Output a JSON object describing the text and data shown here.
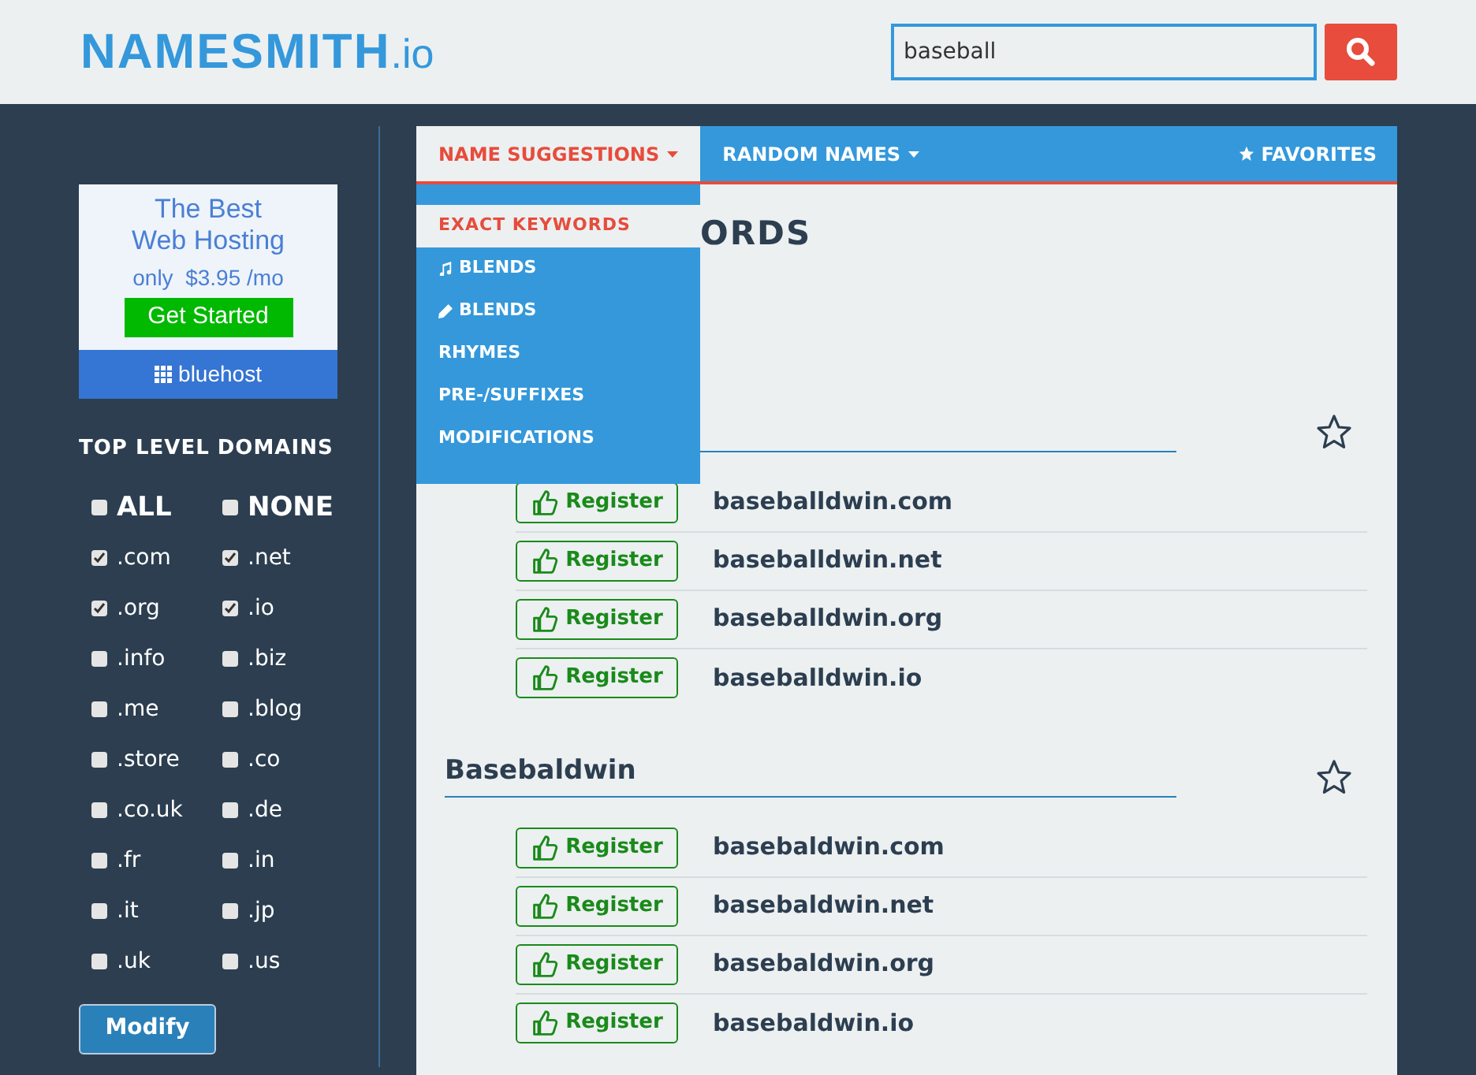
{
  "logo": {
    "name": "NAMESMITH",
    "suffix": ".io"
  },
  "search": {
    "value": "baseball"
  },
  "ad": {
    "line1": "The Best",
    "line2": "Web Hosting",
    "price_prefix": "only",
    "price": "$3.95 /mo",
    "button": "Get Started",
    "brand": "bluehost"
  },
  "sidebar": {
    "title": "TOP LEVEL DOMAINS",
    "options": [
      {
        "label": "ALL",
        "kind": "master",
        "checked": false
      },
      {
        "label": "NONE",
        "kind": "master",
        "checked": false
      },
      {
        "label": ".com",
        "kind": "tld",
        "checked": true
      },
      {
        "label": ".net",
        "kind": "tld",
        "checked": true
      },
      {
        "label": ".org",
        "kind": "tld",
        "checked": true
      },
      {
        "label": ".io",
        "kind": "tld",
        "checked": true
      },
      {
        "label": ".info",
        "kind": "tld",
        "checked": false
      },
      {
        "label": ".biz",
        "kind": "tld",
        "checked": false
      },
      {
        "label": ".me",
        "kind": "tld",
        "checked": false
      },
      {
        "label": ".blog",
        "kind": "tld",
        "checked": false
      },
      {
        "label": ".store",
        "kind": "tld",
        "checked": false
      },
      {
        "label": ".co",
        "kind": "tld",
        "checked": false
      },
      {
        "label": ".co.uk",
        "kind": "tld",
        "checked": false
      },
      {
        "label": ".de",
        "kind": "tld",
        "checked": false
      },
      {
        "label": ".fr",
        "kind": "tld",
        "checked": false
      },
      {
        "label": ".in",
        "kind": "tld",
        "checked": false
      },
      {
        "label": ".it",
        "kind": "tld",
        "checked": false
      },
      {
        "label": ".jp",
        "kind": "tld",
        "checked": false
      },
      {
        "label": ".uk",
        "kind": "tld",
        "checked": false
      },
      {
        "label": ".us",
        "kind": "tld",
        "checked": false
      }
    ],
    "button": "Modify"
  },
  "nav": {
    "tabs": [
      {
        "label": "NAME SUGGESTIONS",
        "selected": true,
        "kind": "dropdown"
      },
      {
        "label": "RANDOM NAMES",
        "selected": false,
        "kind": "dropdown"
      }
    ],
    "favorites": "FAVORITES"
  },
  "dropdown": {
    "items": [
      {
        "label": "EXACT KEYWORDS",
        "selected": true
      },
      {
        "label": "BLENDS",
        "kind": "music",
        "selected": false
      },
      {
        "label": "BLENDS",
        "kind": "pencil",
        "selected": false
      },
      {
        "label": "RHYMES",
        "selected": false
      },
      {
        "label": "PRE-/SUFFIXES",
        "selected": false
      },
      {
        "label": "MODIFICATIONS",
        "selected": false
      }
    ]
  },
  "heading": "ORDS",
  "groups": [
    {
      "domains": [
        {
          "button": "Register",
          "name": "baseballdwin.com"
        },
        {
          "button": "Register",
          "name": "baseballdwin.net"
        },
        {
          "button": "Register",
          "name": "baseballdwin.org"
        },
        {
          "button": "Register",
          "name": "baseballdwin.io"
        }
      ]
    },
    {
      "title": "Basebaldwin",
      "domains": [
        {
          "button": "Register",
          "name": "basebaldwin.com"
        },
        {
          "button": "Register",
          "name": "basebaldwin.net"
        },
        {
          "button": "Register",
          "name": "basebaldwin.org"
        },
        {
          "button": "Register",
          "name": "basebaldwin.io"
        }
      ]
    }
  ]
}
